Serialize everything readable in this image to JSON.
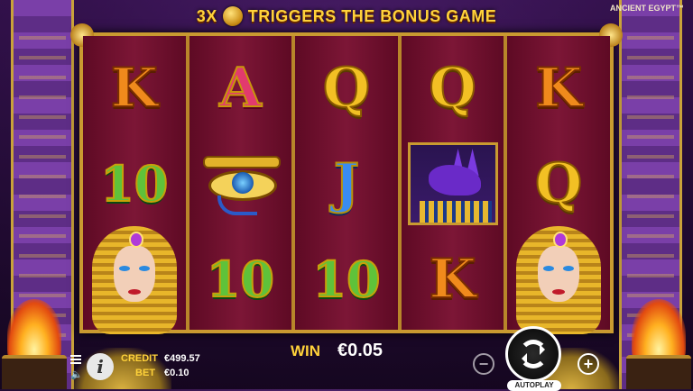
{
  "banner": {
    "prefix": "3X",
    "suffix": "TRIGGERS THE BONUS GAME",
    "icon": "scarab-coin-icon"
  },
  "game_title": "ANCIENT EGYPT™",
  "reels": [
    [
      {
        "symbol": "K"
      },
      {
        "symbol": "10"
      },
      {
        "symbol": "queen",
        "icon": "cleopatra-icon"
      }
    ],
    [
      {
        "symbol": "A"
      },
      {
        "symbol": "eye",
        "icon": "eye-of-horus-icon"
      },
      {
        "symbol": "10"
      }
    ],
    [
      {
        "symbol": "Q"
      },
      {
        "symbol": "J"
      },
      {
        "symbol": "10"
      }
    ],
    [
      {
        "symbol": "Q"
      },
      {
        "symbol": "anubis",
        "icon": "anubis-icon"
      },
      {
        "symbol": "K"
      }
    ],
    [
      {
        "symbol": "K"
      },
      {
        "symbol": "Q"
      },
      {
        "symbol": "queen",
        "icon": "cleopatra-icon"
      }
    ]
  ],
  "hud": {
    "credit_label": "CREDIT",
    "credit_value": "€499.57",
    "bet_label": "BET",
    "bet_value": "€0.10",
    "win_label": "WIN",
    "win_value": "€0.05",
    "info_label": "i",
    "minus_label": "−",
    "plus_label": "+",
    "autoplay_label": "AUTOPLAY"
  },
  "colors": {
    "accent_gold": "#ffd23a",
    "reel_background": "#6e0e2c",
    "frame_gold": "#c99a30"
  }
}
